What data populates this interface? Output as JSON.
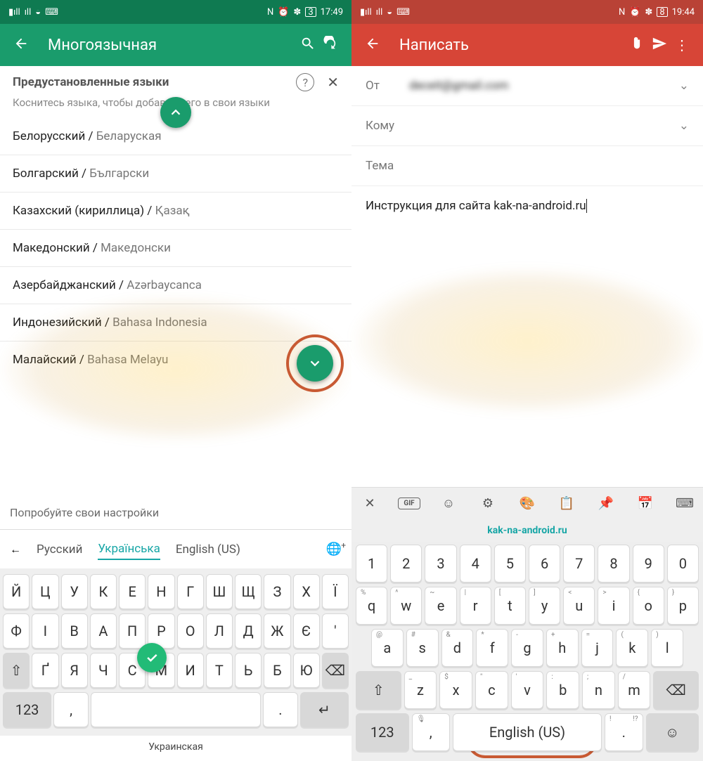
{
  "left": {
    "status": {
      "time": "17:49",
      "battery": "3",
      "icons": [
        "N",
        "⏰",
        "✽"
      ]
    },
    "appbar": {
      "title": "Многоязычная"
    },
    "preset_title": "Предустановленные языки",
    "hint": "Коснитесь языка, чтобы добавить его в свои языки",
    "languages": [
      {
        "ru": "Белорусский",
        "native": "Беларуская"
      },
      {
        "ru": "Болгарский",
        "native": "Български"
      },
      {
        "ru": "Казахский (кириллица)",
        "native": "Қазақ"
      },
      {
        "ru": "Македонский",
        "native": "Македонски"
      },
      {
        "ru": "Азербайджанский",
        "native": "Azərbaycanca"
      },
      {
        "ru": "Индонезийский",
        "native": "Bahasa Indonesia"
      },
      {
        "ru": "Малайский",
        "native": "Bahasa Melayu"
      }
    ],
    "try_settings": "Попробуйте свои настройки",
    "kb_langs": [
      "Русский",
      "Українська",
      "English (US)"
    ],
    "kb_active": 1,
    "kb_rows": [
      [
        "Й",
        "Ц",
        "У",
        "К",
        "Е",
        "Н",
        "Г",
        "Ш",
        "Щ",
        "З",
        "Х",
        "Ї"
      ],
      [
        "Ф",
        "І",
        "В",
        "А",
        "П",
        "Р",
        "О",
        "Л",
        "Д",
        "Ж",
        "Є",
        "'"
      ],
      [
        "⇧",
        "Ґ",
        "Я",
        "Ч",
        "С",
        "М",
        "И",
        "Т",
        "Ь",
        "Б",
        "Ю",
        "⌫"
      ]
    ],
    "kb_bottom": {
      "num": "123",
      "comma": ",",
      "space": "",
      "dot": ".",
      "enter": "↵"
    },
    "kb_caption": "Украинская"
  },
  "right": {
    "status": {
      "time": "19:44",
      "battery": "8",
      "icons": [
        "N",
        "⏰",
        "✽"
      ]
    },
    "appbar": {
      "title": "Написать"
    },
    "from_label": "От",
    "from_value": "deceit@gmail.com",
    "to_label": "Кому",
    "subject_label": "Тема",
    "body": "Инструкция для сайта kak-na-android.ru",
    "suggestion": "kak-na-android.ru",
    "toolbar_icons": [
      "✕",
      "GIF",
      "☺",
      "⚙",
      "🎨",
      "📋",
      "📌",
      "📅",
      "⌨"
    ],
    "num_row": [
      "1",
      "2",
      "3",
      "4",
      "5",
      "6",
      "7",
      "8",
      "9",
      "0"
    ],
    "rows": [
      [
        [
          "%",
          "q"
        ],
        [
          "^",
          "w"
        ],
        [
          "~",
          "e"
        ],
        [
          "|",
          "r"
        ],
        [
          "[",
          "t"
        ],
        [
          "]",
          "y"
        ],
        [
          "<",
          "u"
        ],
        [
          ">",
          "i"
        ],
        [
          "{",
          "o"
        ],
        [
          "}",
          "p"
        ]
      ],
      [
        [
          "@",
          "a"
        ],
        [
          "#",
          "s"
        ],
        [
          "&",
          "d"
        ],
        [
          "*",
          "f"
        ],
        [
          "-",
          "g"
        ],
        [
          "+",
          "h"
        ],
        [
          "=",
          "j"
        ],
        [
          "(",
          "k"
        ],
        [
          ")",
          "l"
        ]
      ],
      [
        [
          "",
          "⇧"
        ],
        [
          "_",
          "z"
        ],
        [
          "$",
          "x"
        ],
        [
          "\"",
          "c"
        ],
        [
          "'",
          "v"
        ],
        [
          ":",
          "b"
        ],
        [
          ";",
          "n"
        ],
        [
          "/",
          "m"
        ],
        [
          "",
          "⌫"
        ]
      ]
    ],
    "bottom": {
      "num": "123",
      "space": "English (US)",
      "smile": "☺"
    },
    "bottom_secondary": {
      "mic": "🎙",
      "exc_left": "!",
      "exc_right": "!?",
      "dot": "."
    }
  }
}
